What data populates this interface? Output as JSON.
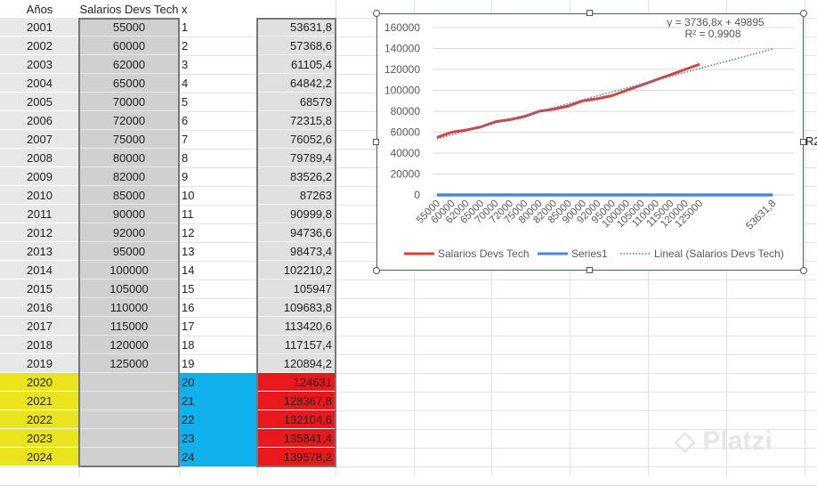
{
  "headers": {
    "a": "Años",
    "b": "Salarios Devs Tech",
    "c": "x",
    "d": ""
  },
  "rows": [
    {
      "year": "2001",
      "salary": "55000",
      "x": "1",
      "pred": "53631,8"
    },
    {
      "year": "2002",
      "salary": "60000",
      "x": "2",
      "pred": "57368,6"
    },
    {
      "year": "2003",
      "salary": "62000",
      "x": "3",
      "pred": "61105,4"
    },
    {
      "year": "2004",
      "salary": "65000",
      "x": "4",
      "pred": "64842,2"
    },
    {
      "year": "2005",
      "salary": "70000",
      "x": "5",
      "pred": "68579"
    },
    {
      "year": "2006",
      "salary": "72000",
      "x": "6",
      "pred": "72315,8"
    },
    {
      "year": "2007",
      "salary": "75000",
      "x": "7",
      "pred": "76052,6"
    },
    {
      "year": "2008",
      "salary": "80000",
      "x": "8",
      "pred": "79789,4"
    },
    {
      "year": "2009",
      "salary": "82000",
      "x": "9",
      "pred": "83526,2"
    },
    {
      "year": "2010",
      "salary": "85000",
      "x": "10",
      "pred": "87263"
    },
    {
      "year": "2011",
      "salary": "90000",
      "x": "11",
      "pred": "90999,8"
    },
    {
      "year": "2012",
      "salary": "92000",
      "x": "12",
      "pred": "94736,6"
    },
    {
      "year": "2013",
      "salary": "95000",
      "x": "13",
      "pred": "98473,4"
    },
    {
      "year": "2014",
      "salary": "100000",
      "x": "14",
      "pred": "102210,2"
    },
    {
      "year": "2015",
      "salary": "105000",
      "x": "15",
      "pred": "105947"
    },
    {
      "year": "2016",
      "salary": "110000",
      "x": "16",
      "pred": "109683,8"
    },
    {
      "year": "2017",
      "salary": "115000",
      "x": "17",
      "pred": "113420,6"
    },
    {
      "year": "2018",
      "salary": "120000",
      "x": "18",
      "pred": "117157,4"
    },
    {
      "year": "2019",
      "salary": "125000",
      "x": "19",
      "pred": "120894,2"
    },
    {
      "year": "2020",
      "salary": "",
      "x": "20",
      "pred": "124631"
    },
    {
      "year": "2021",
      "salary": "",
      "x": "21",
      "pred": "128367,8"
    },
    {
      "year": "2022",
      "salary": "",
      "x": "22",
      "pred": "132104,6"
    },
    {
      "year": "2023",
      "salary": "",
      "x": "23",
      "pred": "135841,4"
    },
    {
      "year": "2024",
      "salary": "",
      "x": "24",
      "pred": "139578,2"
    }
  ],
  "side_text": "R2",
  "logo": "Platzi",
  "chart_data": {
    "type": "line",
    "categories": [
      "55000",
      "60000",
      "62000",
      "65000",
      "70000",
      "72000",
      "75000",
      "80000",
      "82000",
      "85000",
      "90000",
      "92000",
      "95000",
      "100000",
      "105000",
      "110000",
      "115000",
      "120000",
      "125000",
      "",
      "",
      "",
      "",
      "53631,8"
    ],
    "series": [
      {
        "name": "Salarios Devs Tech",
        "color": "#d9423a",
        "values": [
          55000,
          60000,
          62000,
          65000,
          70000,
          72000,
          75000,
          80000,
          82000,
          85000,
          90000,
          92000,
          95000,
          100000,
          105000,
          110000,
          115000,
          120000,
          125000
        ]
      },
      {
        "name": "Series1",
        "color": "#4a86e0",
        "values": [
          1,
          2,
          3,
          4,
          5,
          6,
          7,
          8,
          9,
          10,
          11,
          12,
          13,
          14,
          15,
          16,
          17,
          18,
          19,
          20,
          21,
          22,
          23,
          24
        ]
      }
    ],
    "trendline": {
      "name": "Lineal (Salarios Devs Tech)",
      "color": "#4a7cc8",
      "slope": 3736.8,
      "intercept": 49895,
      "equation": "y = 3736,8x + 49895",
      "r2": "R² = 0,9908"
    },
    "yticks": [
      "0",
      "20000",
      "40000",
      "60000",
      "80000",
      "100000",
      "120000",
      "140000",
      "160000"
    ],
    "ylim": [
      0,
      160000
    ],
    "legend": "bottom"
  }
}
